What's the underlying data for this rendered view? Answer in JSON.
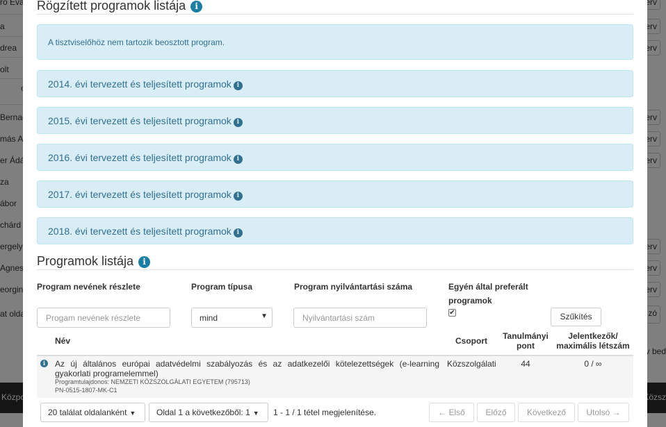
{
  "background": {
    "rows": [
      "ro Éva",
      "a",
      "drea",
      "olt",
      "c",
      "Bernad",
      "más Ar",
      "er Ádá",
      "za",
      "ábor",
      "chárd",
      "ergely",
      "Agnes",
      "eorgina",
      "at olda"
    ],
    "row_button_label": "terv",
    "footer_left": "Közpo",
    "footer_right": "Közsz",
    "side_right_text": "v bed",
    "side_button": "zó"
  },
  "modal": {
    "rogzitett_title": "Rögzített programok listája",
    "no_program_note": "A tisztviselőhöz nem tartozik beosztott program.",
    "year_panels": [
      "2014. évi tervezett és teljesített programok",
      "2015. évi tervezett és teljesített programok",
      "2016. évi tervezett és teljesített programok",
      "2017. évi tervezett és teljesített programok",
      "2018. évi tervezett és teljesített programok"
    ],
    "programs_title": "Programok listája"
  },
  "filters": {
    "name_label": "Program nevének részlete",
    "name_placeholder": "Progam nevének részlete",
    "type_label": "Program típusa",
    "type_value": "mind",
    "regnum_label": "Program nyilvántartási száma",
    "regnum_placeholder": "Nyilvántartási szám",
    "preferred_label_1": "Egyén által preferált",
    "preferred_label_2": "programok",
    "preferred_checked": true,
    "filter_button": "Szűkítés"
  },
  "table": {
    "headers": {
      "name": "Név",
      "group": "Csoport",
      "points_1": "Tanulmányi",
      "points_2": "pont",
      "applicants_1": "Jelentkezők/",
      "applicants_2": "maximális létszám"
    },
    "rows": [
      {
        "name": "Az új általános európai adatvédelmi szabályozás és az adatkezelői kötelezettségek (e-learning gyakorlati programelemmel)",
        "owner": "Programtulajdonos: NEMZETI KÖZSZOLGÁLATI EGYETEM (795713)",
        "code": "PN-0515-1807-MK-C1",
        "group": "Közszolgálati",
        "points": "44",
        "applicants": "0 / ∞"
      }
    ]
  },
  "pagination": {
    "per_page": "20 találat oldalanként",
    "page_of": "Oldal 1 a következőből: 1",
    "summary": "1 - 1 / 1 tétel megjelenítése.",
    "first": "← Első",
    "prev": "Előző",
    "next": "Következő",
    "last": "Utolsó →"
  }
}
